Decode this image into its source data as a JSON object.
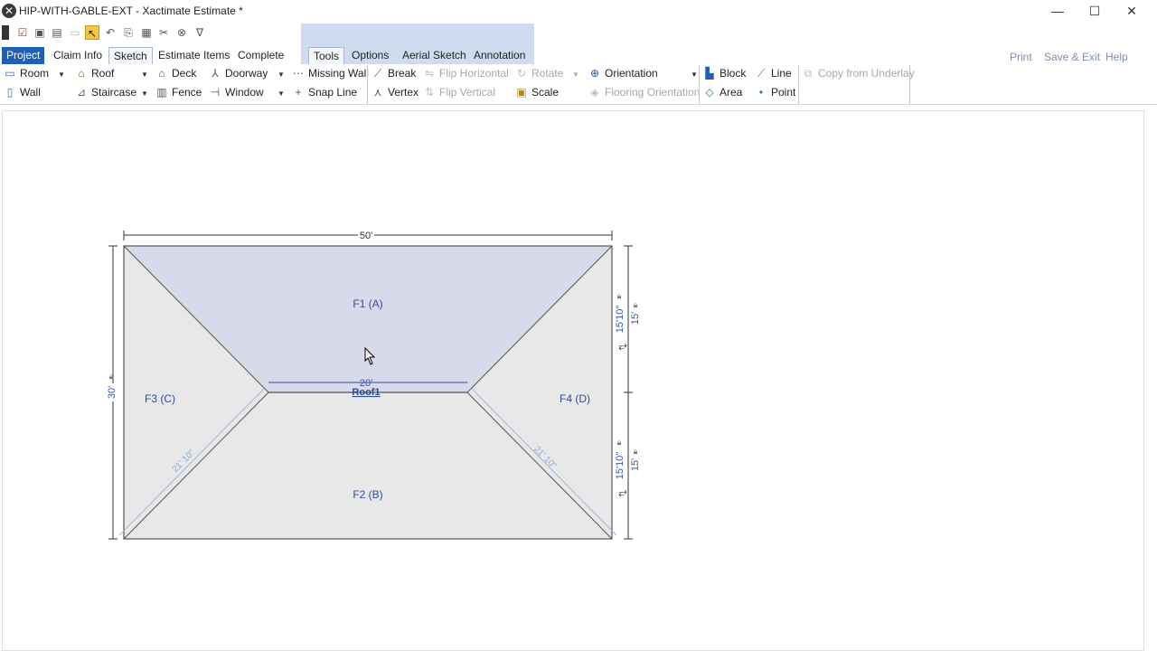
{
  "window": {
    "app_icon": "xactimate-icon",
    "title": "HIP-WITH-GABLE-EXT - Xactimate Estimate *",
    "minimize": "—",
    "maximize": "☐",
    "close": "✕"
  },
  "tabs": {
    "project": "Project",
    "claim_info": "Claim Info",
    "sketch": "Sketch",
    "estimate_items": "Estimate Items",
    "complete": "Complete",
    "tools": "Tools",
    "options": "Options",
    "aerial_sketch": "Aerial Sketch",
    "annotation": "Annotation"
  },
  "header_links": {
    "print": "Print",
    "save_exit": "Save & Exit",
    "help": "Help"
  },
  "ribbon": {
    "room": "Room",
    "wall": "Wall",
    "roof": "Roof",
    "staircase": "Staircase",
    "deck": "Deck",
    "fence": "Fence",
    "doorway": "Doorway",
    "window": "Window",
    "missing_wall": "Missing Wall",
    "snap_line": "Snap Line",
    "break": "Break",
    "vertex": "Vertex",
    "flip_horizontal": "Flip Horizontal",
    "flip_vertical": "Flip Vertical",
    "rotate": "Rotate",
    "scale": "Scale",
    "orientation": "Orientation",
    "flooring_orientation": "Flooring Orientation",
    "block": "Block",
    "area": "Area",
    "line": "Line",
    "point": "Point",
    "copy_from_underlay": "Copy from Underlay"
  },
  "sketch": {
    "roof_name": "Roof1",
    "facets": {
      "f1": "F1 (A)",
      "f2": "F2 (B)",
      "f3": "F3 (C)",
      "f4": "F4 (D)"
    },
    "dims": {
      "top_width": "50'",
      "ridge": "20'",
      "left_height": "30'",
      "right_upper_outer": "15'10\"",
      "right_upper_inner": "15'",
      "right_lower_outer": "15'10\"",
      "right_lower_inner": "15'",
      "hip_left": "21' 10\"",
      "hip_right": "21' 10\""
    },
    "colors": {
      "f1_fill": "#d8d9ea",
      "facet_fill": "#e8e8e8",
      "outline": "#555555",
      "dimension": "#2e4d9c"
    }
  }
}
